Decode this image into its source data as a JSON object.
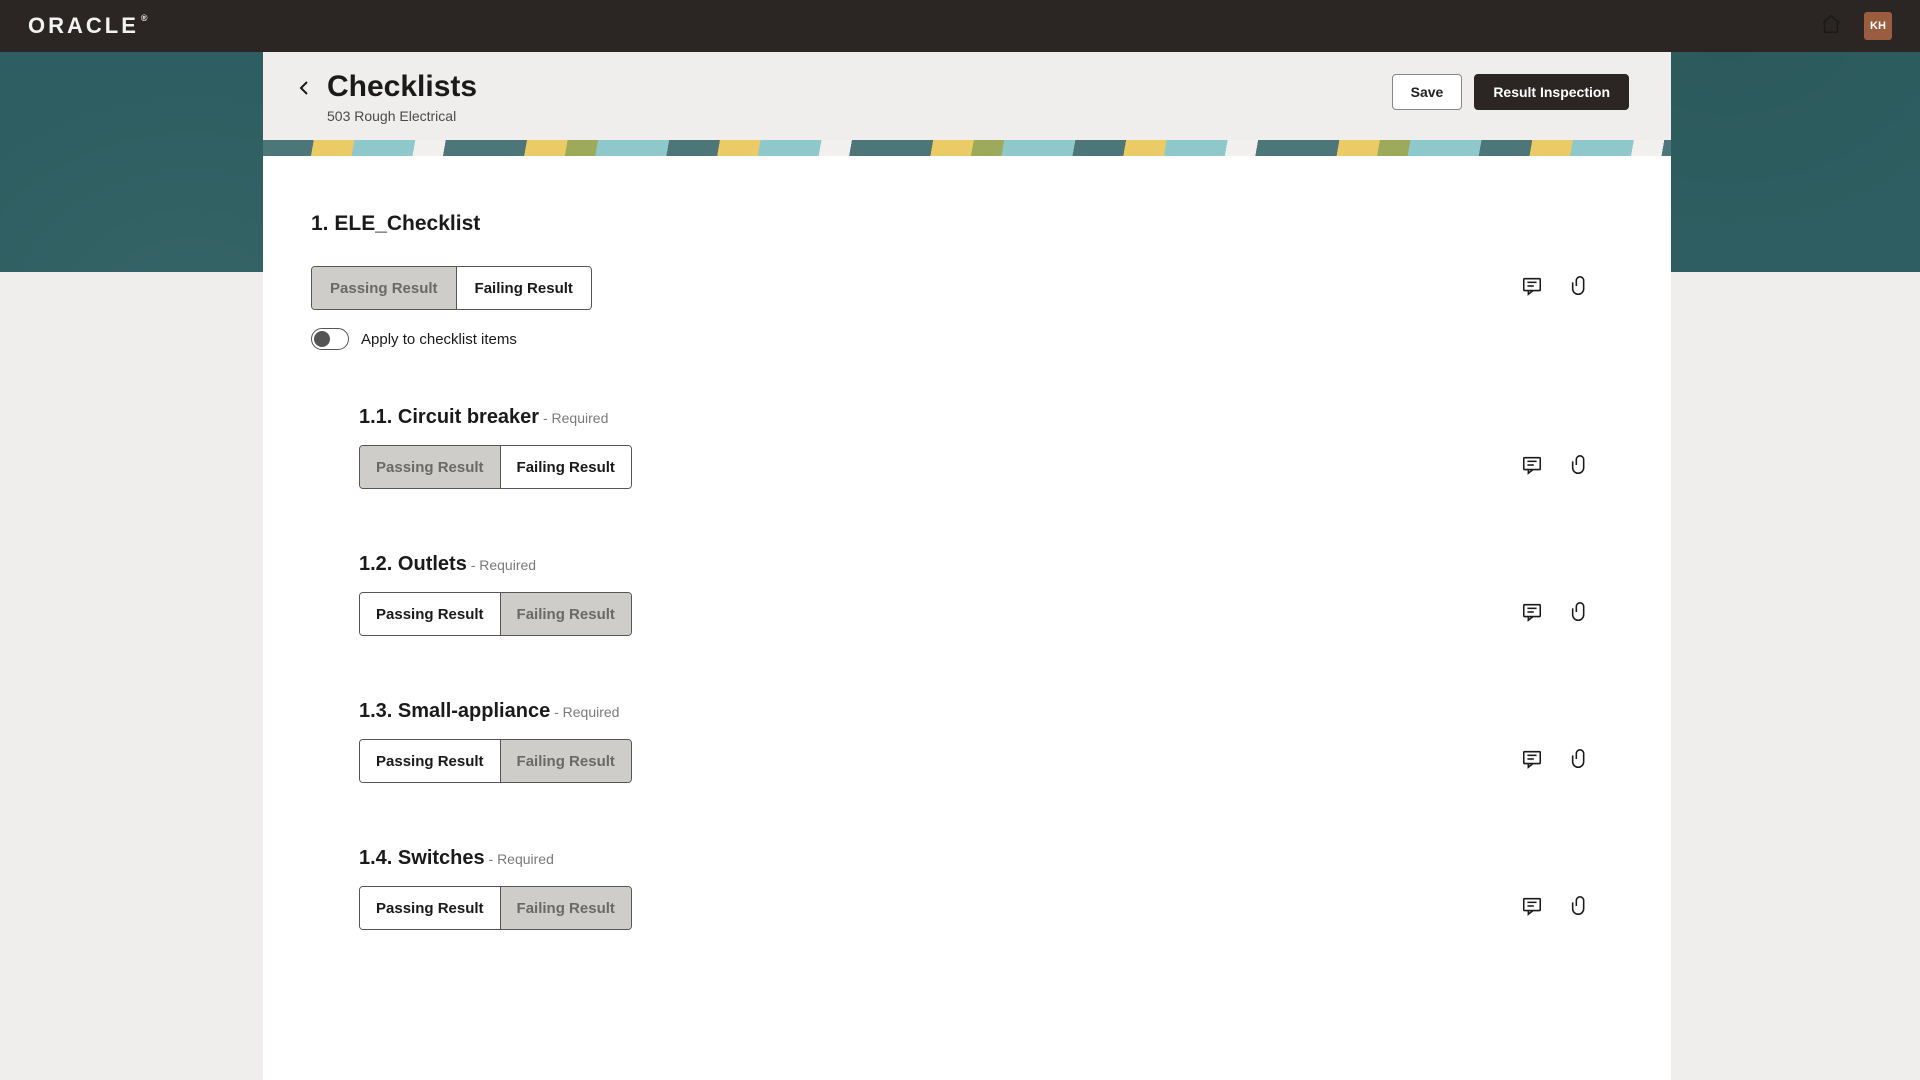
{
  "header": {
    "logo_text": "ORACLE",
    "avatar_initials": "KH"
  },
  "page": {
    "title": "Checklists",
    "subtitle": "503 Rough Electrical",
    "save_label": "Save",
    "result_inspection_label": "Result Inspection"
  },
  "section": {
    "number": "1.",
    "title": "ELE_Checklist",
    "passing_label": "Passing Result",
    "failing_label": "Failing Result",
    "apply_label": "Apply to checklist items",
    "apply_on": false,
    "selected": "passing"
  },
  "items": [
    {
      "number": "1.1.",
      "title": "Circuit breaker",
      "required_label": "Required",
      "selected": "passing"
    },
    {
      "number": "1.2.",
      "title": "Outlets",
      "required_label": "Required",
      "selected": "failing"
    },
    {
      "number": "1.3.",
      "title": "Small-appliance",
      "required_label": "Required",
      "selected": "failing"
    },
    {
      "number": "1.4.",
      "title": "Switches",
      "required_label": "Required",
      "selected": "failing"
    }
  ],
  "labels": {
    "passing": "Passing Result",
    "failing": "Failing Result",
    "required_prefix": " - "
  }
}
